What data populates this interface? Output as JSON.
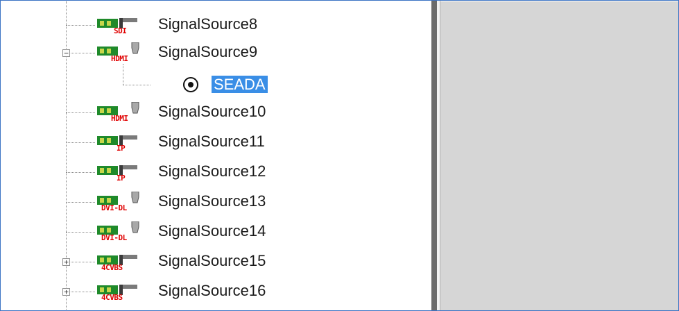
{
  "tree": {
    "nodes": [
      {
        "label": "SignalSource8",
        "badge": "SDI",
        "icon": "board-plug-icon",
        "expander": ""
      },
      {
        "label": "SignalSource9",
        "badge": "HDMI",
        "icon": "board-cable-icon",
        "expander": "−"
      },
      {
        "label": "SignalSource10",
        "badge": "HDMI",
        "icon": "board-cable-icon",
        "expander": ""
      },
      {
        "label": "SignalSource11",
        "badge": "IP",
        "icon": "board-plug-icon",
        "expander": ""
      },
      {
        "label": "SignalSource12",
        "badge": "IP",
        "icon": "board-plug-icon",
        "expander": ""
      },
      {
        "label": "SignalSource13",
        "badge": "DVI-DL",
        "icon": "board-cable-icon",
        "expander": ""
      },
      {
        "label": "SignalSource14",
        "badge": "DVI-DL",
        "icon": "board-cable-icon",
        "expander": ""
      },
      {
        "label": "SignalSource15",
        "badge": "4CVBS",
        "icon": "board-plug-icon",
        "expander": "+"
      },
      {
        "label": "SignalSource16",
        "badge": "4CVBS",
        "icon": "board-plug-icon",
        "expander": "+"
      }
    ],
    "child": {
      "label": "SEADA",
      "icon": "radio-target-icon"
    }
  },
  "colors": {
    "selection": "#3a8ee6",
    "badge_red": "#e00000",
    "board_green": "#1f8a2a",
    "right_pane": "#d6d6d6"
  }
}
